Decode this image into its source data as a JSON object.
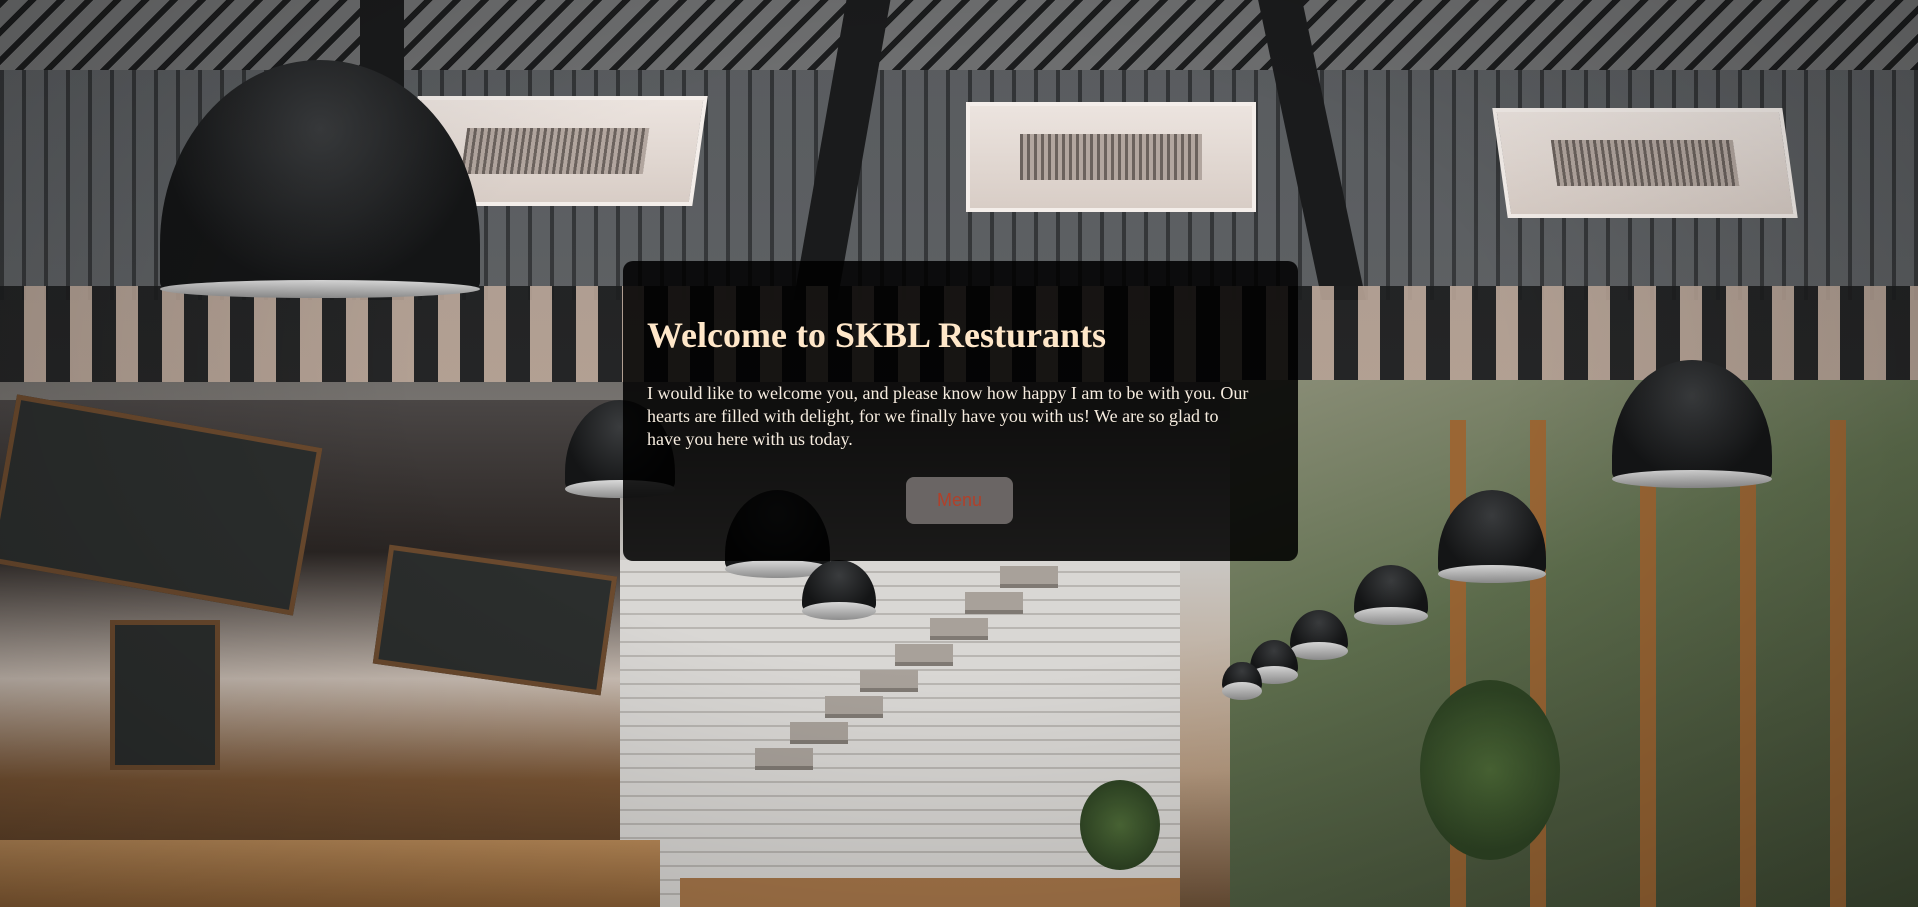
{
  "background": {
    "image": "restaurant-interior-photo"
  },
  "welcome": {
    "title": "Welcome to SKBL Resturants",
    "message": "I would like to welcome you, and please know how happy I am to be with you. Our hearts are filled with delight, for we finally have you with us! We are so glad to have you here with us today.",
    "menu_button": "Menu"
  },
  "colors": {
    "title_color": "#ffe7c9",
    "text_color": "#f6ecdf",
    "panel_background": "#000000",
    "button_background": "#6a6564",
    "button_text": "#b1402a"
  }
}
